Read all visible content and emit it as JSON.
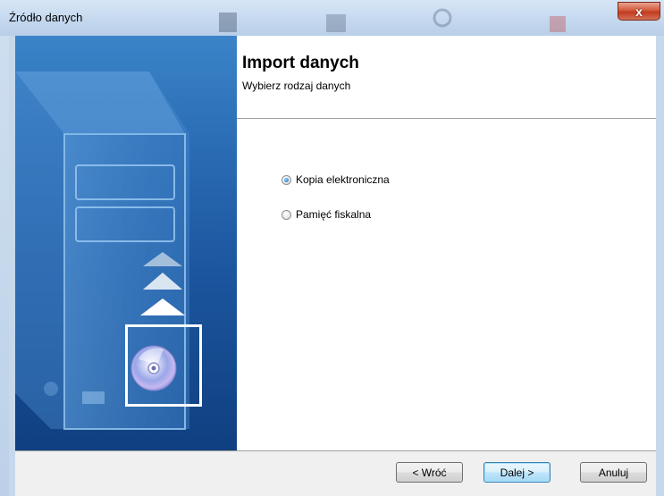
{
  "window": {
    "title": "Źródło danych",
    "close_glyph": "x"
  },
  "wizard": {
    "heading": "Import danych",
    "subheading": "Wybierz rodzaj danych"
  },
  "options": [
    {
      "label": "Kopia elektroniczna",
      "selected": true
    },
    {
      "label": "Pamięć fiskalna",
      "selected": false
    }
  ],
  "buttons": {
    "back_label": "< Wróć",
    "next_label": "Dalej >",
    "cancel_label": "Anuluj"
  },
  "colors": {
    "side_panel": "#1d57a0",
    "close_button": "#c23b1e",
    "default_button_border": "#3c7fb1"
  },
  "icons": {
    "side_panel": [
      "computer-tower-icon",
      "import-arrows-icon",
      "cd-disc-icon"
    ]
  }
}
